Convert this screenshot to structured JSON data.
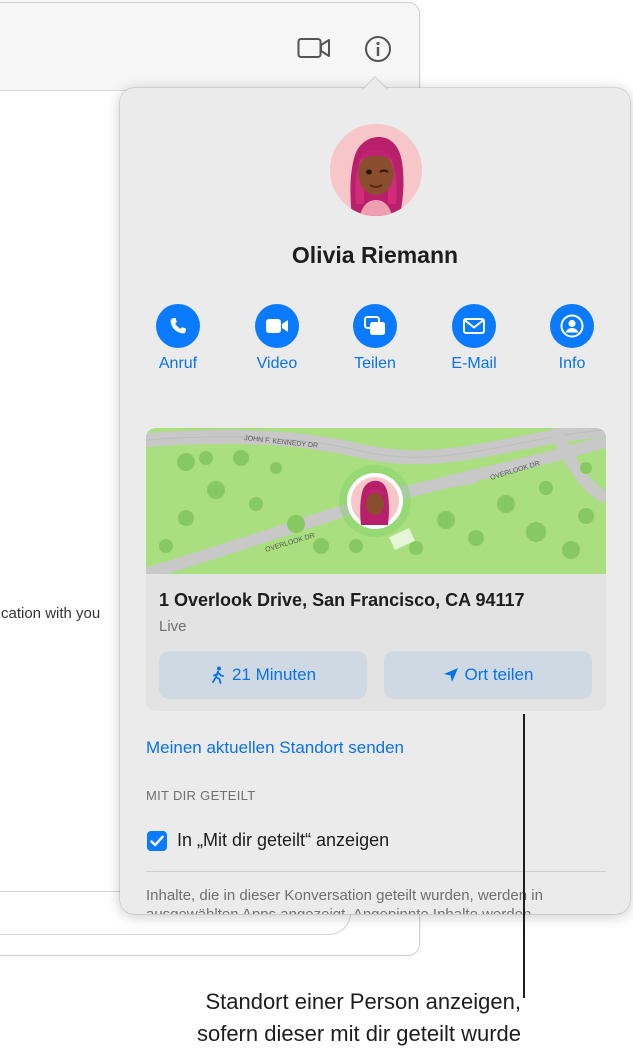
{
  "background_window": {
    "chat_fragment": "cation with you"
  },
  "contact": {
    "name": "Olivia Riemann"
  },
  "actions": [
    {
      "label": "Anruf",
      "icon": "phone-icon"
    },
    {
      "label": "Video",
      "icon": "video-icon"
    },
    {
      "label": "Teilen",
      "icon": "share-screen-icon"
    },
    {
      "label": "E-Mail",
      "icon": "mail-icon"
    },
    {
      "label": "Info",
      "icon": "person-icon"
    }
  ],
  "map": {
    "street_labels": [
      "JOHN F. KENNEDY DR",
      "OVERLOOK DR",
      "OVERLOOK DR"
    ]
  },
  "location": {
    "address": "1 Overlook Drive, San Francisco, CA 94117",
    "status": "Live",
    "directions_label": "21 Minuten",
    "share_label": "Ort teilen"
  },
  "send_location_link": "Meinen aktuellen Standort senden",
  "shared_section": {
    "heading": "MIT DIR GETEILT",
    "checkbox_label": "In „Mit dir geteilt“ anzeigen",
    "checked": true,
    "info_text": "Inhalte, die in dieser Konversation geteilt wurden, werden in ausgewählten Apps angezeigt. Angepinnte Inhalte werden"
  },
  "caption": {
    "line1": "Standort einer Person anzeigen,",
    "line2": "sofern dieser mit dir geteilt wurde"
  },
  "colors": {
    "accent": "#0a7aff",
    "map_green": "#a9df7e",
    "popover_bg": "#ebebeb"
  }
}
